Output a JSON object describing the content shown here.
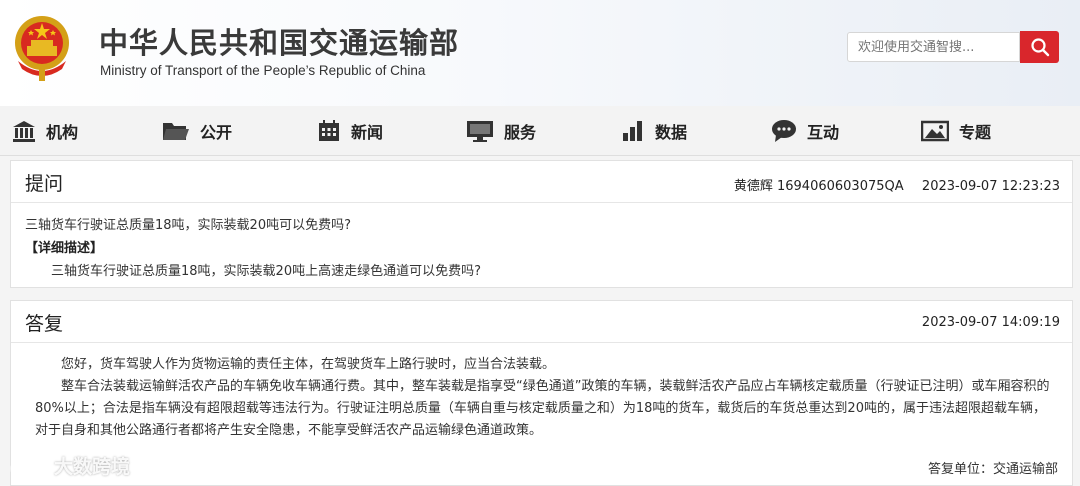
{
  "header": {
    "title_cn": "中华人民共和国交通运输部",
    "title_en": "Ministry of Transport of the People’s Republic of China",
    "search_placeholder": "欢迎使用交通智搜...",
    "accent_color": "#d9262c"
  },
  "nav": {
    "items": [
      {
        "label": "机构",
        "icon": "building-icon"
      },
      {
        "label": "公开",
        "icon": "folder-icon"
      },
      {
        "label": "新闻",
        "icon": "calendar-icon"
      },
      {
        "label": "服务",
        "icon": "monitor-icon"
      },
      {
        "label": "数据",
        "icon": "bar-chart-icon"
      },
      {
        "label": "互动",
        "icon": "chat-icon"
      },
      {
        "label": "专题",
        "icon": "picture-icon"
      }
    ]
  },
  "question": {
    "heading": "提问",
    "asker": "黄德辉 1694060603075QA",
    "time": "2023-09-07 12:23:23",
    "text": "三轴货车行驶证总质量18吨，实际装载20吨可以免费吗?",
    "detail_label": "【详细描述】",
    "detail_text": "三轴货车行驶证总质量18吨，实际装载20吨上高速走绿色通道可以免费吗?"
  },
  "answer": {
    "heading": "答复",
    "time": "2023-09-07 14:09:19",
    "paragraphs": [
      "您好，货车驾驶人作为货物运输的责任主体，在驾驶货车上路行驶时，应当合法装载。",
      "整车合法装载运输鲜活农产品的车辆免收车辆通行费。其中，整车装载是指享受“绿色通道”政策的车辆，装载鲜活农产品应占车辆核定载质量（行驶证已注明）或车厢容积的80%以上；合法是指车辆没有超限超载等违法行为。行驶证注明总质量（车辆自重与核定载质量之和）为18吨的货车，载货后的车货总重达到20吨的，属于违法超限超载车辆，对于自身和其他公路通行者都将产生安全隐患，不能享受鲜活农产品运输绿色通道政策。"
    ],
    "unit": "答复单位：交通运输部"
  },
  "watermark": {
    "text": "大数跨境"
  }
}
